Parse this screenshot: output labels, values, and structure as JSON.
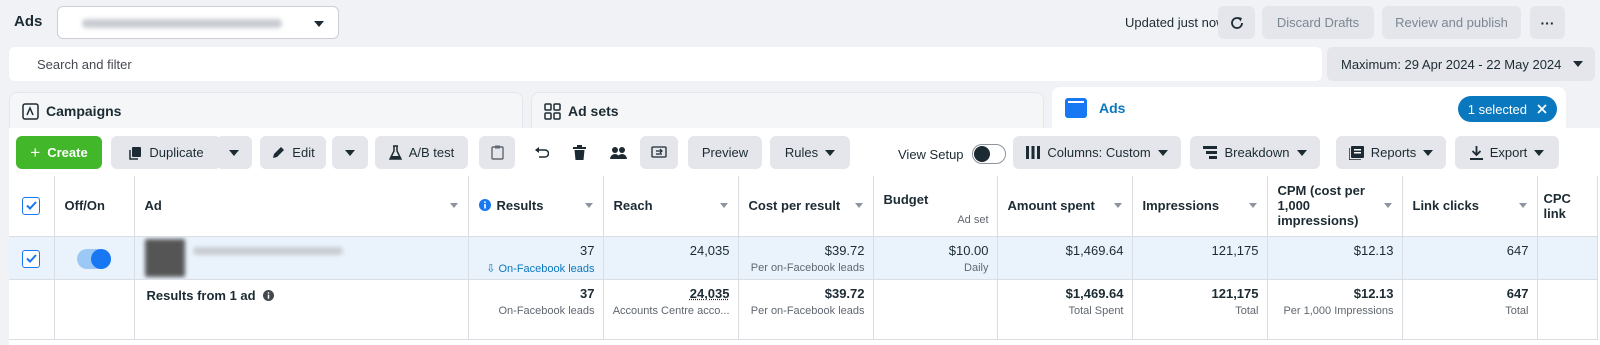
{
  "app": {
    "title": "Ads",
    "updated": "Updated just now"
  },
  "header": {
    "discard_label": "Discard Drafts",
    "review_label": "Review and publish",
    "more_label": "···"
  },
  "search": {
    "placeholder": "Search and filter"
  },
  "date_range": "Maximum: 29 Apr 2024 - 22 May 2024",
  "tabs": {
    "campaigns": "Campaigns",
    "adsets": "Ad sets",
    "ads": "Ads",
    "selected": "1 selected"
  },
  "toolbar": {
    "create": "Create",
    "duplicate": "Duplicate",
    "edit": "Edit",
    "ab_test": "A/B test",
    "preview": "Preview",
    "rules": "Rules",
    "view_setup": "View Setup",
    "columns": "Columns: Custom",
    "breakdown": "Breakdown",
    "reports": "Reports",
    "export": "Export"
  },
  "table": {
    "headers": {
      "offon": "Off/On",
      "ad": "Ad",
      "results": "Results",
      "reach": "Reach",
      "cpr": "Cost per result",
      "budget": "Budget",
      "budget_sub": "Ad set",
      "amount": "Amount spent",
      "impressions": "Impressions",
      "cpm": "CPM (cost per 1,000 impressions)",
      "clicks": "Link clicks",
      "cpc": "CPC link"
    },
    "row": {
      "results": "37",
      "results_sub": "On-Facebook leads",
      "reach": "24,035",
      "cpr": "$39.72",
      "cpr_sub": "Per on-Facebook leads",
      "budget": "$10.00",
      "budget_sub": "Daily",
      "amount": "$1,469.64",
      "impressions": "121,175",
      "cpm": "$12.13",
      "clicks": "647"
    },
    "summary": {
      "label": "Results from 1 ad",
      "results": "37",
      "results_sub": "On-Facebook leads",
      "reach": "24,035",
      "reach_sub": "Accounts Centre acco...",
      "cpr": "$39.72",
      "cpr_sub": "Per on-Facebook leads",
      "amount": "$1,469.64",
      "amount_sub": "Total Spent",
      "impressions": "121,175",
      "impressions_sub": "Total",
      "cpm": "$12.13",
      "cpm_sub": "Per 1,000 Impressions",
      "clicks": "647",
      "clicks_sub": "Total"
    }
  },
  "colors": {
    "accent": "#0a78be",
    "create_green": "#42b72a",
    "selected_row": "#eaf3fc"
  }
}
